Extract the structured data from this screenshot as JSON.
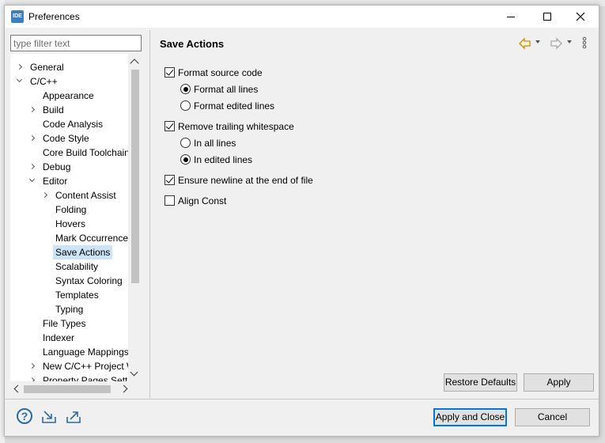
{
  "window": {
    "title": "Preferences",
    "app_icon_text": "IDE"
  },
  "filter": {
    "placeholder": "type filter text"
  },
  "tree": [
    {
      "label": "General",
      "level": 0,
      "twisty": "closed"
    },
    {
      "label": "C/C++",
      "level": 0,
      "twisty": "open"
    },
    {
      "label": "Appearance",
      "level": 1,
      "twisty": "none"
    },
    {
      "label": "Build",
      "level": 1,
      "twisty": "closed"
    },
    {
      "label": "Code Analysis",
      "level": 1,
      "twisty": "none"
    },
    {
      "label": "Code Style",
      "level": 1,
      "twisty": "closed"
    },
    {
      "label": "Core Build Toolchains",
      "level": 1,
      "twisty": "none"
    },
    {
      "label": "Debug",
      "level": 1,
      "twisty": "closed"
    },
    {
      "label": "Editor",
      "level": 1,
      "twisty": "open"
    },
    {
      "label": "Content Assist",
      "level": 2,
      "twisty": "closed"
    },
    {
      "label": "Folding",
      "level": 2,
      "twisty": "none"
    },
    {
      "label": "Hovers",
      "level": 2,
      "twisty": "none"
    },
    {
      "label": "Mark Occurrences",
      "level": 2,
      "twisty": "none"
    },
    {
      "label": "Save Actions",
      "level": 2,
      "twisty": "none",
      "selected": true
    },
    {
      "label": "Scalability",
      "level": 2,
      "twisty": "none"
    },
    {
      "label": "Syntax Coloring",
      "level": 2,
      "twisty": "none"
    },
    {
      "label": "Templates",
      "level": 2,
      "twisty": "none"
    },
    {
      "label": "Typing",
      "level": 2,
      "twisty": "none"
    },
    {
      "label": "File Types",
      "level": 1,
      "twisty": "none"
    },
    {
      "label": "Indexer",
      "level": 1,
      "twisty": "none"
    },
    {
      "label": "Language Mappings",
      "level": 1,
      "twisty": "none"
    },
    {
      "label": "New C/C++ Project W",
      "level": 1,
      "twisty": "closed"
    },
    {
      "label": "Property Pages Settin",
      "level": 1,
      "twisty": "closed"
    }
  ],
  "page": {
    "title": "Save Actions",
    "options": {
      "format_source": {
        "label": "Format source code",
        "checked": true
      },
      "format_all": {
        "label": "Format all lines",
        "checked": true
      },
      "format_edited": {
        "label": "Format edited lines",
        "checked": false
      },
      "remove_ws": {
        "label": "Remove trailing whitespace",
        "checked": true
      },
      "in_all": {
        "label": "In all lines",
        "checked": false
      },
      "in_edited": {
        "label": "In edited lines",
        "checked": true
      },
      "ensure_newline": {
        "label": "Ensure newline at the end of file",
        "checked": true
      },
      "align_const": {
        "label": "Align Const",
        "checked": false
      }
    },
    "restore_defaults": "Restore Defaults",
    "apply": "Apply"
  },
  "footer": {
    "apply_close": "Apply and Close",
    "cancel": "Cancel"
  },
  "colors": {
    "selection": "#cce4f7",
    "accent": "#0078d7",
    "nav_back": "#e0a030"
  }
}
